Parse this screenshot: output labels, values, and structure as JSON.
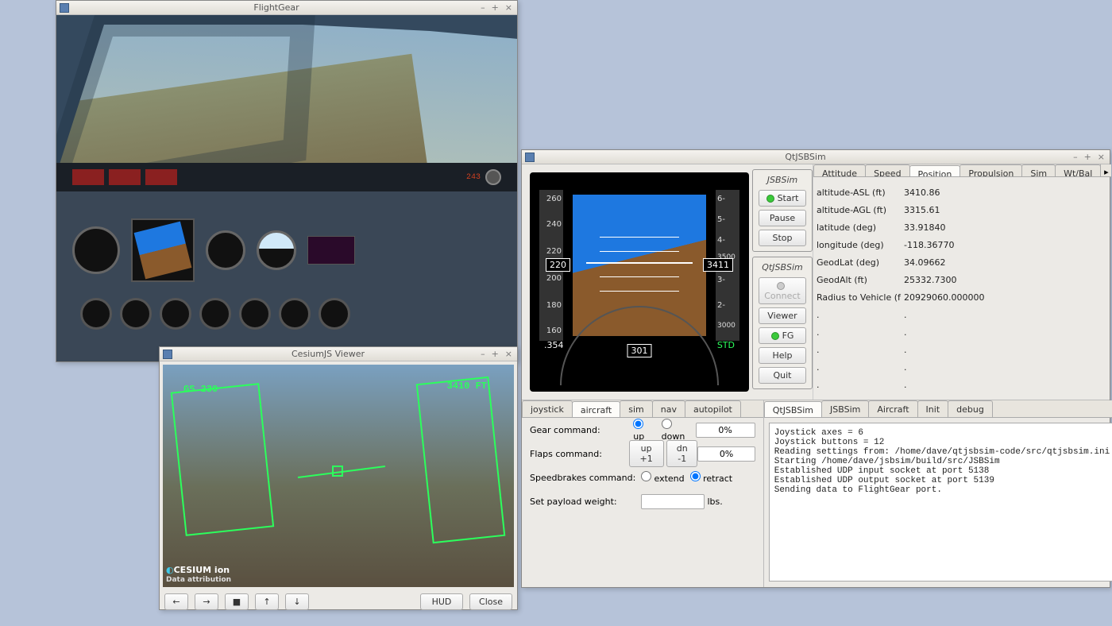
{
  "fg": {
    "title": "FlightGear"
  },
  "cesium": {
    "title": "CesiumJS Viewer",
    "gs": "GS 230",
    "alt": "3410 FT",
    "logo": "CESIUM ion",
    "attrib": "Data attribution",
    "btn_left": "←",
    "btn_right": "→",
    "btn_stop": "■",
    "btn_up": "↑",
    "btn_down": "↓",
    "btn_hud": "HUD",
    "btn_close": "Close"
  },
  "qt": {
    "title": "QtJSBSim",
    "jsb_label": "JSBSim",
    "start": "Start",
    "pause": "Pause",
    "stop": "Stop",
    "qtjsb_label": "QtJSBSim",
    "connect": "Connect",
    "viewer": "Viewer",
    "fg": "FG",
    "help": "Help",
    "quit": "Quit",
    "data_tabs": [
      "Attitude",
      "Speed",
      "Position",
      "Propulsion",
      "Sim",
      "Wt/Bal"
    ],
    "data_active": 2,
    "rows": [
      {
        "k": "altitude-ASL (ft)",
        "v": "3410.86"
      },
      {
        "k": "altitude-AGL (ft)",
        "v": "3315.61"
      },
      {
        "k": "latitude (deg)",
        "v": "33.91840"
      },
      {
        "k": "longitude (deg)",
        "v": "-118.36770"
      },
      {
        "k": "GeodLat (deg)",
        "v": "34.09662"
      },
      {
        "k": "GeodAlt (ft)",
        "v": "25332.7300"
      },
      {
        "k": "Radius to Vehicle (f",
        "v": "20929060.000000"
      },
      {
        "k": ".",
        "v": "."
      },
      {
        "k": ".",
        "v": "."
      },
      {
        "k": ".",
        "v": "."
      },
      {
        "k": ".",
        "v": "."
      },
      {
        "k": ".",
        "v": "."
      }
    ],
    "lower_tabs": [
      "joystick",
      "aircraft",
      "sim",
      "nav",
      "autopilot"
    ],
    "lower_active": 1,
    "gear_label": "Gear command:",
    "gear_up": "up",
    "gear_down": "down",
    "gear_pct": "0%",
    "flaps_label": "Flaps command:",
    "flaps_up": "up +1",
    "flaps_dn": "dn -1",
    "flaps_pct": "0%",
    "sb_label": "Speedbrakes command:",
    "sb_ext": "extend",
    "sb_ret": "retract",
    "payload_label": "Set payload weight:",
    "payload_unit": "lbs.",
    "log_tabs": [
      "QtJSBSim",
      "JSBSim",
      "Aircraft",
      "Init",
      "debug"
    ],
    "log_text": "Joystick axes = 6\nJoystick buttons = 12\nReading settings from: /home/dave/qtjsbsim-code/src/qtjsbsim.ini\nStarting /home/dave/jsbsim/build/src/JSBSim\nEstablished UDP input socket at port 5138\nEstablished UDP output socket at port 5139\nSending data to FlightGear port.",
    "pfd": {
      "spd_ticks": [
        "260",
        "240",
        "220",
        "200",
        "180",
        "160"
      ],
      "alt_ticks": [
        "6-",
        "5-",
        "4-",
        "3500",
        "3-",
        "2-",
        "3000"
      ],
      "spd": "220",
      "alt": "3411",
      "mach": ".354",
      "hdg": "301",
      "std": "STD"
    }
  }
}
